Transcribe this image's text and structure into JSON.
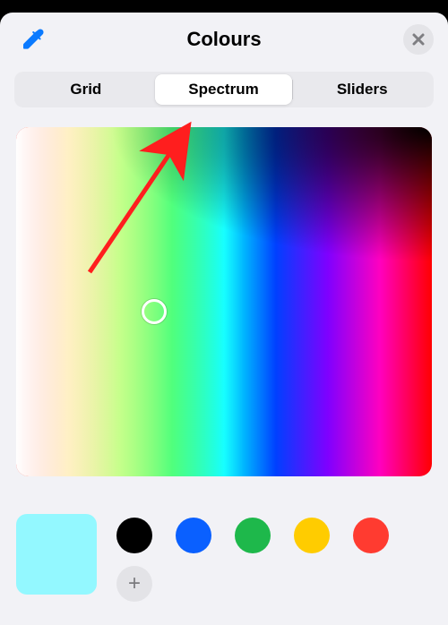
{
  "header": {
    "title": "Colours",
    "eyedropper_icon": "eyedropper",
    "close_icon": "close"
  },
  "tabs": {
    "items": [
      {
        "label": "Grid",
        "active": false
      },
      {
        "label": "Spectrum",
        "active": true
      },
      {
        "label": "Sliders",
        "active": false
      }
    ]
  },
  "spectrum": {
    "reticle_color": "#47f2ff"
  },
  "current_color": "#93f8ff",
  "preset_swatches": [
    "#000000",
    "#0a60ff",
    "#1eb84b",
    "#ffcc00",
    "#ff3b30"
  ],
  "add_swatch_glyph": "+",
  "annotation": {
    "type": "arrow",
    "color": "#ff1e1e",
    "points_to": "tab-spectrum"
  }
}
